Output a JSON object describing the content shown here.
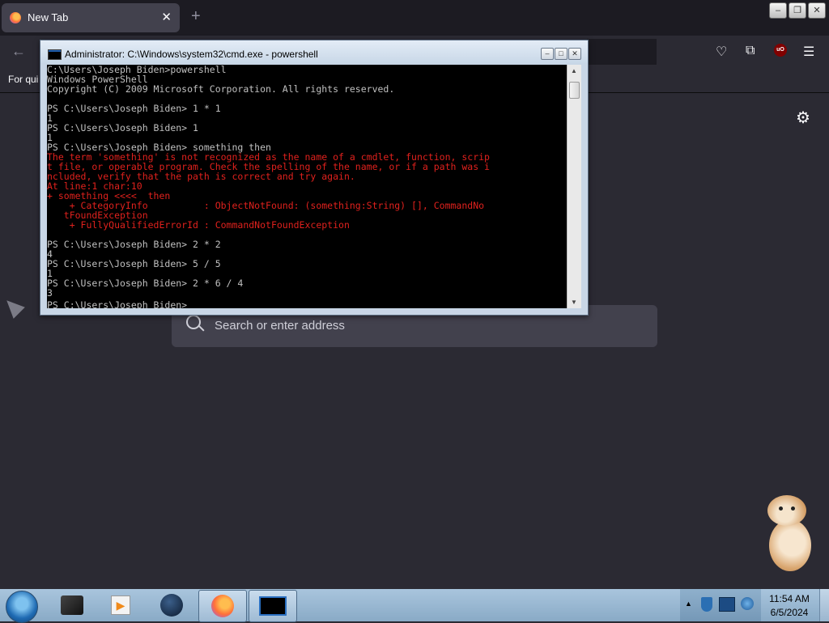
{
  "browser": {
    "tab_title": "New Tab",
    "tab_close": "✕",
    "new_tab": "+",
    "back": "←",
    "bookmarks_text": "For qui",
    "search_placeholder": "Search or enter address",
    "ublock_label": "uO",
    "window_buttons": [
      "–",
      "❐",
      "✕"
    ]
  },
  "cmd_window": {
    "title": "Administrator: C:\\Windows\\system32\\cmd.exe - powershell",
    "buttons": [
      "–",
      "□",
      "✕"
    ],
    "lines": [
      {
        "text": "C:\\Users\\Joseph Biden>powershell",
        "err": false
      },
      {
        "text": "Windows PowerShell",
        "err": false
      },
      {
        "text": "Copyright (C) 2009 Microsoft Corporation. All rights reserved.",
        "err": false
      },
      {
        "text": "",
        "err": false
      },
      {
        "text": "PS C:\\Users\\Joseph Biden> 1 * 1",
        "err": false
      },
      {
        "text": "1",
        "err": false
      },
      {
        "text": "PS C:\\Users\\Joseph Biden> 1",
        "err": false
      },
      {
        "text": "1",
        "err": false
      },
      {
        "text": "PS C:\\Users\\Joseph Biden> something then",
        "err": false
      },
      {
        "text": "The term 'something' is not recognized as the name of a cmdlet, function, scrip",
        "err": true
      },
      {
        "text": "t file, or operable program. Check the spelling of the name, or if a path was i",
        "err": true
      },
      {
        "text": "ncluded, verify that the path is correct and try again.",
        "err": true
      },
      {
        "text": "At line:1 char:10",
        "err": true
      },
      {
        "text": "+ something <<<<  then",
        "err": true
      },
      {
        "text": "    + CategoryInfo          : ObjectNotFound: (something:String) [], CommandNo",
        "err": true
      },
      {
        "text": "   tFoundException",
        "err": true
      },
      {
        "text": "    + FullyQualifiedErrorId : CommandNotFoundException",
        "err": true
      },
      {
        "text": "",
        "err": false
      },
      {
        "text": "PS C:\\Users\\Joseph Biden> 2 * 2",
        "err": false
      },
      {
        "text": "4",
        "err": false
      },
      {
        "text": "PS C:\\Users\\Joseph Biden> 5 / 5",
        "err": false
      },
      {
        "text": "1",
        "err": false
      },
      {
        "text": "PS C:\\Users\\Joseph Biden> 2 * 6 / 4",
        "err": false
      },
      {
        "text": "3",
        "err": false
      },
      {
        "text": "PS C:\\Users\\Joseph Biden> ",
        "err": false,
        "cursor": true
      }
    ]
  },
  "taskbar": {
    "clock_time": "11:54 AM",
    "clock_date": "6/5/2024",
    "items": [
      "terminal-app",
      "media-player",
      "globe-app",
      "firefox",
      "cmd-window"
    ]
  },
  "colors": {
    "error_text": "#e0211d",
    "console_text": "#c0c0c0",
    "browser_bg": "#2b2a33"
  }
}
